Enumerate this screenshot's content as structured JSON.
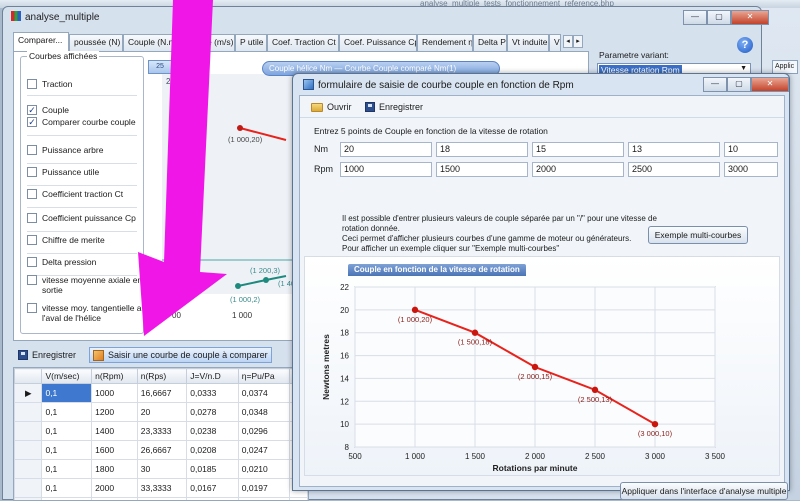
{
  "background": {
    "faint_text_1": "analyse_multiple_tests_fonctionnement_reference.bhp",
    "faint_text_2": "Flux de fonctionnement ressorti",
    "faint_text_3": "Applic",
    "faint_text_4": "ve"
  },
  "main_window": {
    "title": "analyse_multiple",
    "tabs": [
      "Comparer...",
      "poussée (N)",
      "Couple (N.m)",
      "Vitesse (m/s)",
      "P utile",
      "Coef. Traction Ct",
      "Coef. Puissance Cp",
      "Rendement η",
      "Delta P",
      "Vt induite",
      "V"
    ],
    "tab_scroll_left": "◂",
    "tab_scroll_right": "▸",
    "curves_group_title": "Courbes affichées",
    "curves": [
      {
        "label": "Traction",
        "checked": false
      },
      {
        "label": "Couple",
        "checked": true
      },
      {
        "label": "Comparer courbe couple",
        "checked": true
      },
      {
        "label": "Puissance arbre",
        "checked": false
      },
      {
        "label": "Puissance utile",
        "checked": false
      },
      {
        "label": "Coefficient traction Ct",
        "checked": false
      },
      {
        "label": "Coefficient puissance Cp",
        "checked": false
      },
      {
        "label": "Chiffre de merite",
        "checked": false
      },
      {
        "label": "Delta pression",
        "checked": false
      },
      {
        "label": "vitesse moyenne axiale en sortie",
        "checked": false
      },
      {
        "label": "vitesse moy. tangentielle a l'aval de l'hélice",
        "checked": false
      }
    ],
    "check_mark": "✓",
    "badge": "25",
    "legend": "Couple hélice Nm  —  Courbe Couple comparé Nm(1)",
    "under_chart": {
      "top_label": "25",
      "point_labels": [
        "(1 000,20)",
        "(1",
        "(1 200,3)",
        "(1 400",
        "(1 000,2)"
      ],
      "x_ticks": [
        "00",
        "1 000"
      ]
    },
    "param_label": "Parametre variant:",
    "param_value": "Vitesse rotation Rpm",
    "param_arrow": "▼",
    "help": "?",
    "toolbar": {
      "save": "Enregistrer",
      "enter_curve": "Saisir une courbe de couple à comparer"
    },
    "grid": {
      "headers": [
        "V(m/sec)",
        "n(Rpm)",
        "n(Rps)",
        "J=V/n.D",
        "η=Pu/Pa"
      ],
      "rows": [
        [
          "0,1",
          "1000",
          "16,6667",
          "0,0333",
          "0,0374"
        ],
        [
          "0,1",
          "1200",
          "20",
          "0,0278",
          "0,0348"
        ],
        [
          "0,1",
          "1400",
          "23,3333",
          "0,0238",
          "0,0296"
        ],
        [
          "0,1",
          "1600",
          "26,6667",
          "0,0208",
          "0,0247"
        ],
        [
          "0,1",
          "1800",
          "30",
          "0,0185",
          "0,0210"
        ],
        [
          "0,1",
          "2000",
          "33,3333",
          "0,0167",
          "0,0197"
        ],
        [
          "0,1",
          "2200",
          "36,6667",
          "0,0152",
          "0,0171"
        ]
      ],
      "current_row_marker": "▶"
    }
  },
  "dialog": {
    "title": "formulaire de saisie de courbe couple en fonction de Rpm",
    "open": "Ouvrir",
    "save": "Enregistrer",
    "instructions": "Entrez 5 points de Couple en fonction de la vitesse de rotation",
    "nm_label": "Nm",
    "rpm_label": "Rpm",
    "nm_values": [
      "20",
      "18",
      "15",
      "13",
      "10"
    ],
    "rpm_values": [
      "1000",
      "1500",
      "2000",
      "2500",
      "3000"
    ],
    "info_line_1": "Il est possible d'entrer plusieurs valeurs de couple séparée par un \"/\" pour une vitesse de rotation donnée.",
    "info_line_2": "Ceci permet d'afficher plusieurs courbes d'une gamme de moteur ou générateurs.",
    "info_line_3": "Pour afficher un exemple cliquer sur \"Exemple multi-courbes\"",
    "example_button": "Exemple multi-courbes",
    "apply_button": "Appliquer dans l'interface d'analyse multiple"
  },
  "chart_data": {
    "type": "line",
    "title": "Couple en fonction de la vitesse de rotation",
    "xlabel": "Rotations par minute",
    "ylabel": "Newtons metres",
    "xlim": [
      500,
      3500
    ],
    "ylim": [
      8,
      22
    ],
    "x_ticks": [
      500,
      1000,
      1500,
      2000,
      2500,
      3000,
      3500
    ],
    "x_tick_labels": [
      "500",
      "1 000",
      "1 500",
      "2 000",
      "2 500",
      "3 000",
      "3 500"
    ],
    "y_ticks": [
      8,
      10,
      12,
      14,
      16,
      18,
      20,
      22
    ],
    "grid": true,
    "series": [
      {
        "color": "#e8231c",
        "x": [
          1000,
          1500,
          2000,
          2500,
          3000
        ],
        "y": [
          20,
          18,
          15,
          13,
          10
        ],
        "point_labels": [
          "(1 000,20)",
          "(1 500,18)",
          "(2 000,15)",
          "(2 500,13)",
          "(3 000,10)"
        ]
      }
    ]
  },
  "colors": {
    "accent": "#3b6fc5",
    "arrow": "#f016e8",
    "series": "#e8231c"
  }
}
